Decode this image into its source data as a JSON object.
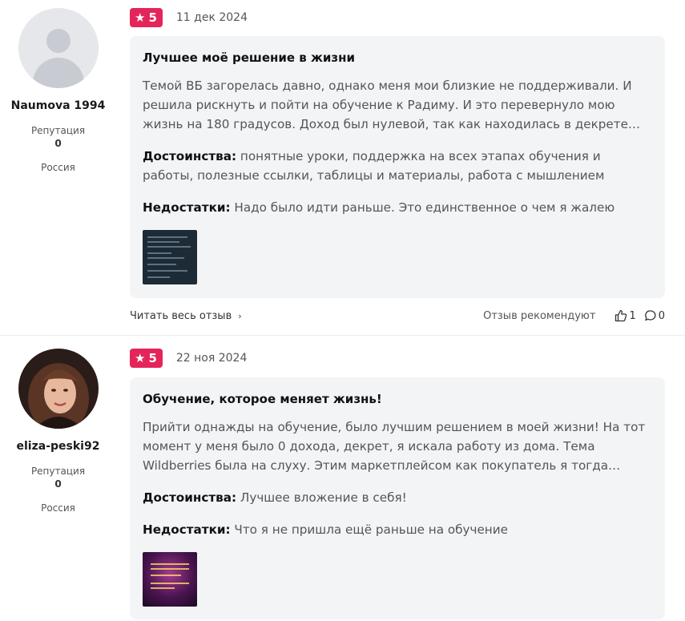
{
  "reviews": [
    {
      "user": {
        "name": "Naumova 1994",
        "reputation_label": "Репутация",
        "reputation": "0",
        "country": "Россия",
        "avatar_icon": "default-user-icon"
      },
      "rating": "5",
      "date": "11 дек 2024",
      "title": "Лучшее моё решение в жизни",
      "text": "Темой ВБ загорелась давно, однако меня мои близкие не поддерживали. И решила рискнуть и пойти на обучение к Радиму. И это перевернуло мою жизнь на 180 градусов. Доход был нулевой, так как находилась в декрете…",
      "pros_label": "Достоинства:",
      "pros": "понятные уроки, поддержка на всех этапах обучения и работы, полезные ссылки, таблицы и материалы, работа с мышлением",
      "cons_label": "Недостатки:",
      "cons": "Надо было идти раньше. Это единственное о чем я жалею",
      "read_more": "Читать весь отзыв",
      "recommend_label": "Отзыв рекомендуют",
      "likes": "1",
      "comments": "0"
    },
    {
      "user": {
        "name": "eliza-peski92",
        "reputation_label": "Репутация",
        "reputation": "0",
        "country": "Россия",
        "avatar_icon": "user-photo"
      },
      "rating": "5",
      "date": "22 ноя 2024",
      "title": "Обучение, которое меняет жизнь!",
      "text": "Прийти однажды на обучение, было лучшим решением в моей жизни! На тот момент у меня было 0 дохода, декрет, я искала работу из дома. Тема Wildberries была на слуху. Этим маркетплейсом как покупатель я тогда…",
      "pros_label": "Достоинства:",
      "pros": "Лучшее вложение в себя!",
      "cons_label": "Недостатки:",
      "cons": "Что я не пришла ещё раньше на обучение"
    }
  ],
  "colors": {
    "rating_badge": "#e4255a",
    "card_bg": "#f3f4f6"
  }
}
